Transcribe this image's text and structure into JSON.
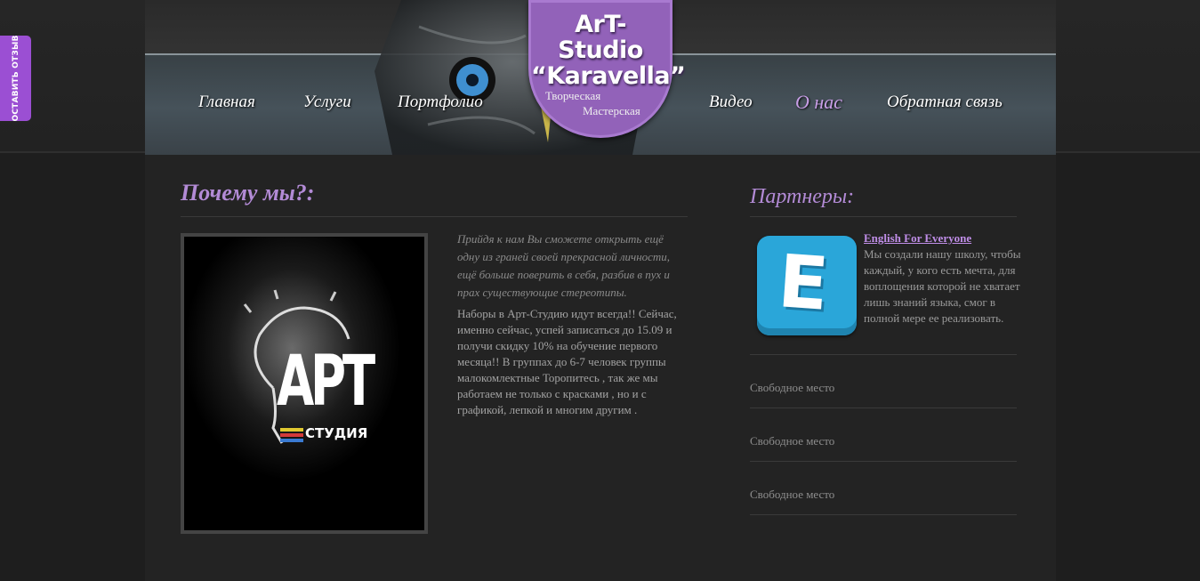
{
  "side_tab": {
    "label": "ОСТАВИТЬ ОТЗЫВ"
  },
  "logo": {
    "line1": "ArT-",
    "line2": "Studio",
    "line3": "“Karavella”",
    "sub1": "Творческая",
    "sub2": "Мастерская"
  },
  "nav": {
    "items": [
      {
        "label": "Главная"
      },
      {
        "label": "Услуги"
      },
      {
        "label": "Портфолио"
      },
      {
        "label": "Видео"
      },
      {
        "label": "О нас"
      },
      {
        "label": "Обратная связь"
      }
    ],
    "active": "О нас"
  },
  "main": {
    "title": "Почему мы?:",
    "art_text": {
      "big": "АРТ",
      "small": "СТУДИЯ"
    },
    "intro": "Прийдя к нам Вы сможете открыть ещё одну из граней своей прекрасной личности, ещё больше поверить в себя, разбив в пух и прах существующие стереотипы.",
    "body": "Наборы в Арт-Студию идут всегда!! Сейчас, именно сейчас, успей записаться до 15.09 и получи скидку 10% на обучение первого месяца!! В группах до 6-7 человек группы малокомлектные Торопитесь , так же мы работаем не только с красками , но и с графикой, лепкой и многим другим ."
  },
  "partners": {
    "title": "Партнеры:",
    "featured": {
      "name": "English For Everyone",
      "logo_letter": "E",
      "description": "Мы создали нашу школу, чтобы каждый, у кого есть мечта, для воплощения которой не хватает лишь знаний языка, смог в полной мере ее реализовать."
    },
    "free_slots": [
      "Свободное место",
      "Свободное место",
      "Свободное место"
    ]
  },
  "colors": {
    "accent": "#9262b9",
    "heading": "#b38bd6",
    "link": "#c08ee8",
    "side_tab": "#9b4fd3"
  }
}
